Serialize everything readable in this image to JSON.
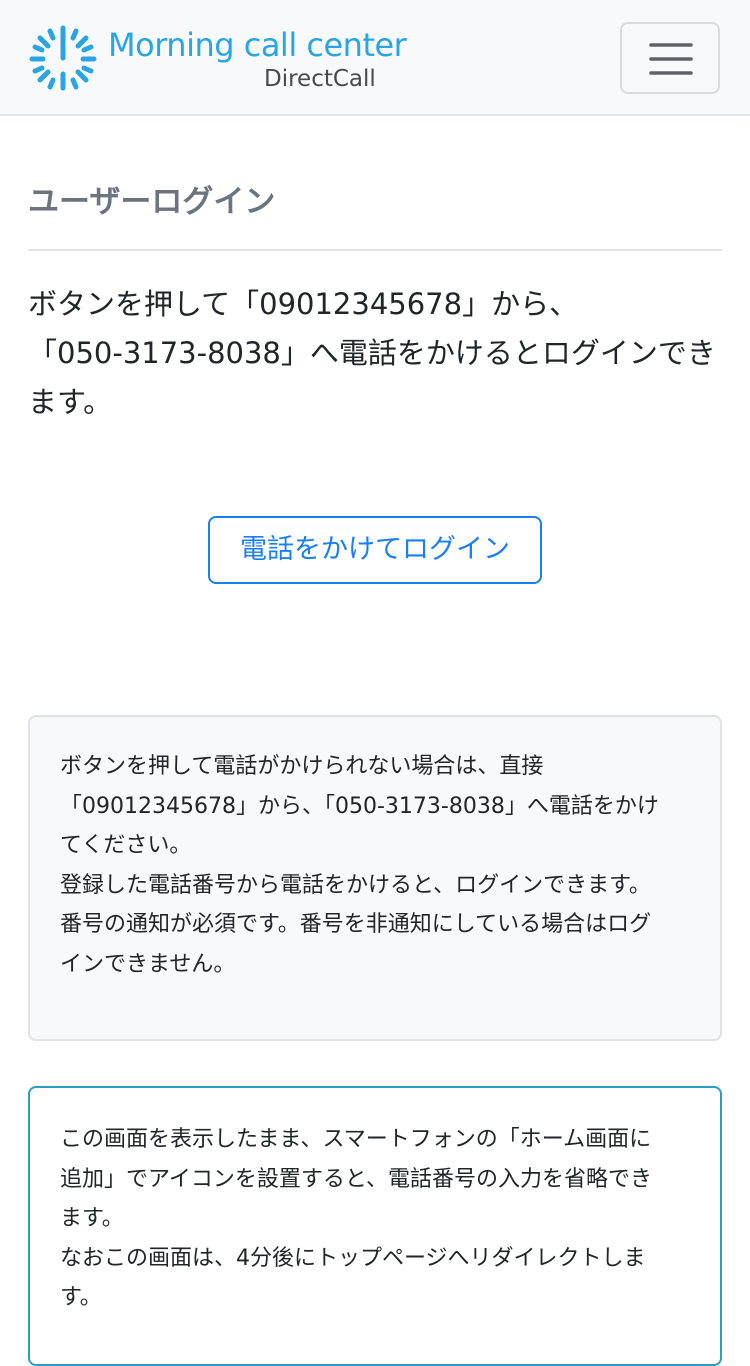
{
  "header": {
    "brand_title": "Morning call center",
    "brand_subtitle": "DirectCall",
    "logo_icon": "sunburst-icon",
    "menu_icon": "hamburger-icon",
    "brand_color": "#2aa5e3"
  },
  "main": {
    "heading": "ユーザーログイン",
    "intro_lines": [
      "ボタンを押して「09012345678」から、",
      "「050-3173-8038」へ電話をかけるとログインでき",
      "ます。"
    ],
    "call_button_label": "電話をかけてログイン",
    "accent_color": "#1a7ff2"
  },
  "notice": {
    "lines": [
      "ボタンを押して電話がかけられない場合は、直接",
      "「09012345678」から、「050-3173-8038」へ電話をかけ",
      "てください。",
      "登録した電話番号から電話をかけると、ログインできます。",
      "番号の通知が必須です。番号を非通知にしている場合はログ",
      "インできません。"
    ]
  },
  "info": {
    "lines": [
      "この画面を表示したまま、スマートフォンの「ホーム画面に",
      "追加」でアイコンを設置すると、電話番号の入力を省略でき",
      "ます。",
      "なおこの画面は、4分後にトップページへリダイレクトしま",
      "す。"
    ],
    "border_color": "#2c9fc0"
  }
}
